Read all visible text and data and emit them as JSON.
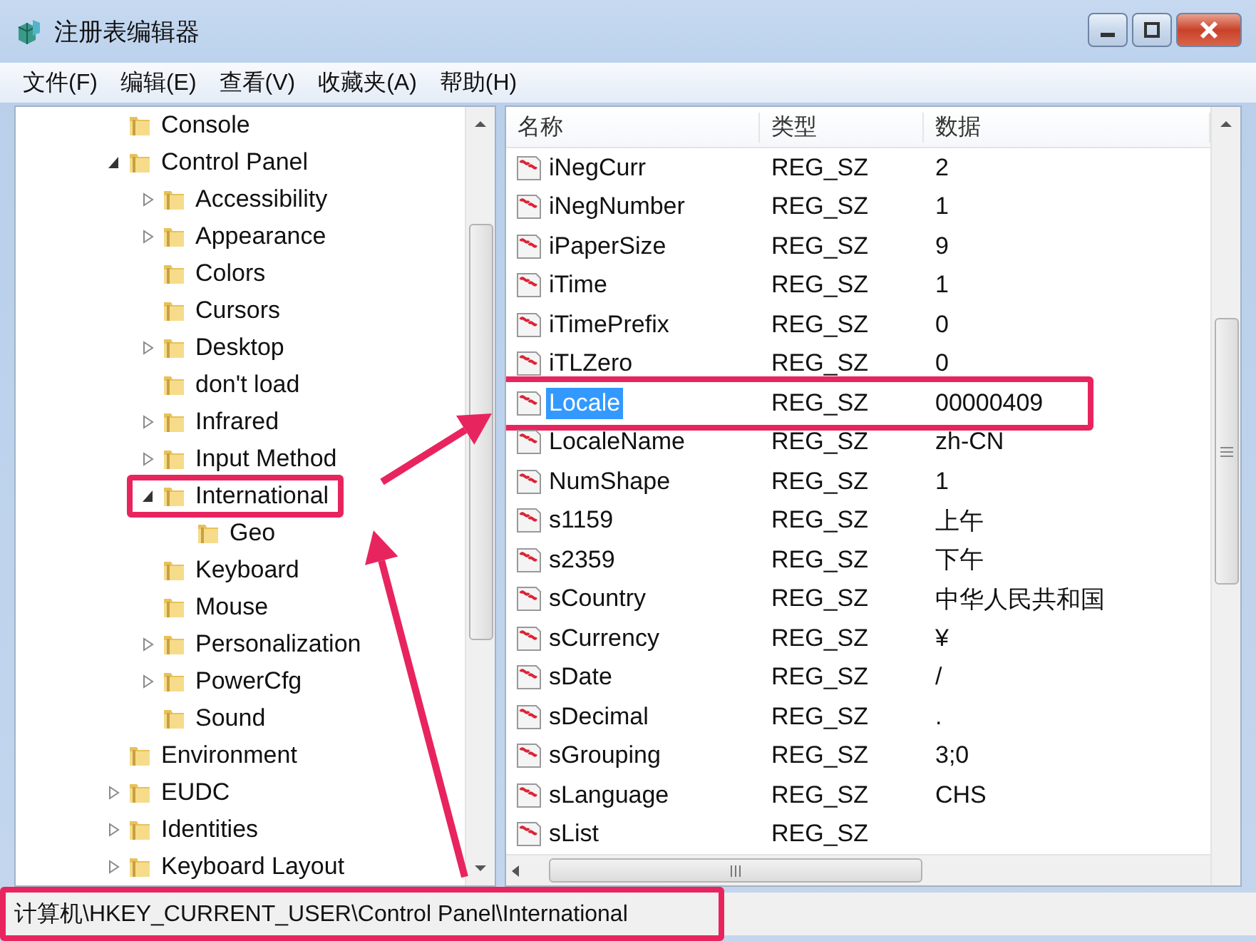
{
  "window": {
    "title": "注册表编辑器"
  },
  "menu": [
    "文件(F)",
    "编辑(E)",
    "查看(V)",
    "收藏夹(A)",
    "帮助(H)"
  ],
  "tree": [
    {
      "label": "Console",
      "expandable": false,
      "highlighted": false
    },
    {
      "label": "Control Panel",
      "expandable": true,
      "expanded": true,
      "highlighted": false,
      "children": [
        {
          "label": "Accessibility",
          "expandable": true,
          "expanded": false,
          "highlighted": false
        },
        {
          "label": "Appearance",
          "expandable": true,
          "expanded": false,
          "highlighted": false
        },
        {
          "label": "Colors",
          "expandable": false,
          "highlighted": false
        },
        {
          "label": "Cursors",
          "expandable": false,
          "highlighted": false
        },
        {
          "label": "Desktop",
          "expandable": true,
          "expanded": false,
          "highlighted": false
        },
        {
          "label": "don't load",
          "expandable": false,
          "highlighted": false
        },
        {
          "label": "Infrared",
          "expandable": true,
          "expanded": false,
          "highlighted": false
        },
        {
          "label": "Input Method",
          "expandable": true,
          "expanded": false,
          "highlighted": false
        },
        {
          "label": "International",
          "expandable": true,
          "expanded": true,
          "highlighted": true,
          "children": [
            {
              "label": "Geo",
              "expandable": false,
              "highlighted": false
            }
          ]
        },
        {
          "label": "Keyboard",
          "expandable": false,
          "highlighted": false
        },
        {
          "label": "Mouse",
          "expandable": false,
          "highlighted": false
        },
        {
          "label": "Personalization",
          "expandable": true,
          "expanded": false,
          "highlighted": false
        },
        {
          "label": "PowerCfg",
          "expandable": true,
          "expanded": false,
          "highlighted": false
        },
        {
          "label": "Sound",
          "expandable": false,
          "highlighted": false
        }
      ]
    },
    {
      "label": "Environment",
      "expandable": false,
      "highlighted": false
    },
    {
      "label": "EUDC",
      "expandable": true,
      "expanded": false,
      "highlighted": false
    },
    {
      "label": "Identities",
      "expandable": true,
      "expanded": false,
      "highlighted": false
    },
    {
      "label": "Keyboard Layout",
      "expandable": true,
      "expanded": false,
      "highlighted": false
    }
  ],
  "list": {
    "columns": [
      "名称",
      "类型",
      "数据"
    ],
    "rows": [
      {
        "name": "iNegCurr",
        "type": "REG_SZ",
        "data": "2",
        "selected": false,
        "highlighted": false
      },
      {
        "name": "iNegNumber",
        "type": "REG_SZ",
        "data": "1",
        "selected": false,
        "highlighted": false
      },
      {
        "name": "iPaperSize",
        "type": "REG_SZ",
        "data": "9",
        "selected": false,
        "highlighted": false
      },
      {
        "name": "iTime",
        "type": "REG_SZ",
        "data": "1",
        "selected": false,
        "highlighted": false
      },
      {
        "name": "iTimePrefix",
        "type": "REG_SZ",
        "data": "0",
        "selected": false,
        "highlighted": false
      },
      {
        "name": "iTLZero",
        "type": "REG_SZ",
        "data": "0",
        "selected": false,
        "highlighted": false
      },
      {
        "name": "Locale",
        "type": "REG_SZ",
        "data": "00000409",
        "selected": true,
        "highlighted": true
      },
      {
        "name": "LocaleName",
        "type": "REG_SZ",
        "data": "zh-CN",
        "selected": false,
        "highlighted": false
      },
      {
        "name": "NumShape",
        "type": "REG_SZ",
        "data": "1",
        "selected": false,
        "highlighted": false
      },
      {
        "name": "s1159",
        "type": "REG_SZ",
        "data": "上午",
        "selected": false,
        "highlighted": false
      },
      {
        "name": "s2359",
        "type": "REG_SZ",
        "data": "下午",
        "selected": false,
        "highlighted": false
      },
      {
        "name": "sCountry",
        "type": "REG_SZ",
        "data": "中华人民共和国",
        "selected": false,
        "highlighted": false
      },
      {
        "name": "sCurrency",
        "type": "REG_SZ",
        "data": "¥",
        "selected": false,
        "highlighted": false
      },
      {
        "name": "sDate",
        "type": "REG_SZ",
        "data": "/",
        "selected": false,
        "highlighted": false
      },
      {
        "name": "sDecimal",
        "type": "REG_SZ",
        "data": ".",
        "selected": false,
        "highlighted": false
      },
      {
        "name": "sGrouping",
        "type": "REG_SZ",
        "data": "3;0",
        "selected": false,
        "highlighted": false
      },
      {
        "name": "sLanguage",
        "type": "REG_SZ",
        "data": "CHS",
        "selected": false,
        "highlighted": false
      },
      {
        "name": "sList",
        "type": "REG_SZ",
        "selected": false,
        "highlighted": false
      }
    ]
  },
  "status_bar": {
    "path": "计算机\\HKEY_CURRENT_USER\\Control Panel\\International",
    "highlighted": true
  }
}
